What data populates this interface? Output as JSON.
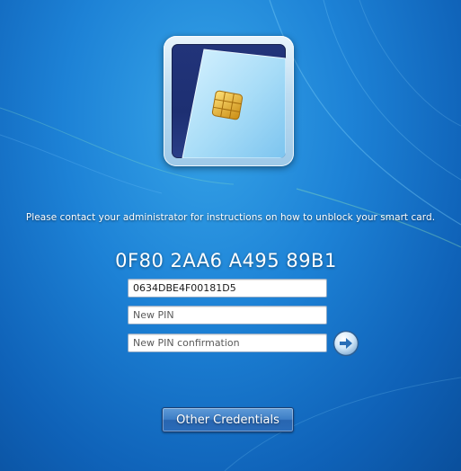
{
  "message": "Please contact your administrator for instructions on how to unblock your smart card.",
  "card_id": "0F80 2AA6 A495 89B1",
  "fields": {
    "puk_value": "0634DBE4F00181D5",
    "new_pin_placeholder": "New PIN",
    "new_pin_confirm_placeholder": "New PIN confirmation"
  },
  "icons": {
    "tile": "smart-card-icon",
    "submit": "arrow-right-icon"
  },
  "buttons": {
    "other_credentials": "Other Credentials"
  },
  "colors": {
    "background": "#1d82d6",
    "tile_inner": "#1d2f72",
    "chip": "#e0a21c"
  }
}
